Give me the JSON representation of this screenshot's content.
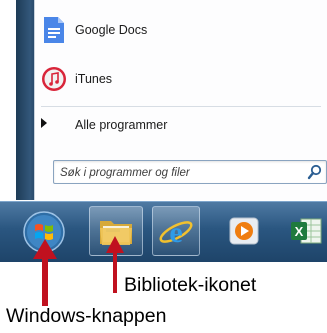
{
  "start_menu": {
    "programs": [
      {
        "label": "Google Docs",
        "icon": "google-docs-icon"
      },
      {
        "label": "iTunes",
        "icon": "itunes-icon"
      }
    ],
    "all_programs_label": "Alle programmer",
    "search": {
      "placeholder": "Søk i programmer og filer",
      "icon": "search-icon"
    }
  },
  "taskbar": {
    "buttons": [
      {
        "name": "windows-start-orb",
        "icon": "windows-logo-icon"
      },
      {
        "name": "library-button",
        "icon": "folder-icon"
      },
      {
        "name": "internet-explorer-button",
        "icon": "internet-explorer-icon"
      },
      {
        "name": "media-player-button",
        "icon": "media-player-icon"
      },
      {
        "name": "excel-button",
        "icon": "excel-icon"
      }
    ]
  },
  "annotations": {
    "library_caption": "Bibliotek-ikonet",
    "windows_caption": "Windows-knappen",
    "arrow_color": "#c0111f"
  },
  "colors": {
    "taskbar": "#2a5680",
    "start_menu_frame": "#2a4b6c"
  }
}
